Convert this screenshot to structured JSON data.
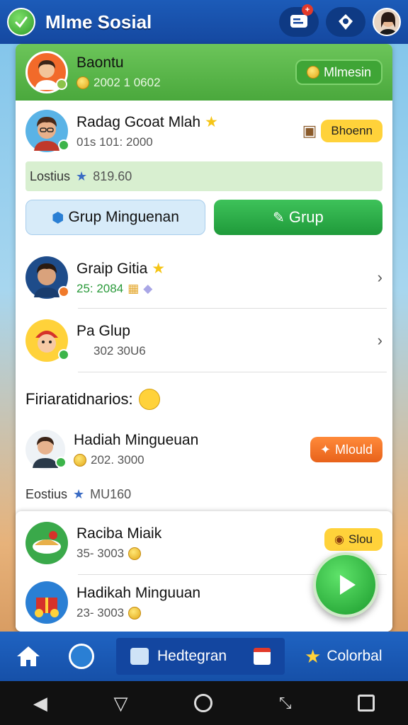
{
  "app": {
    "title": "Mlme Sosial",
    "notification_badge": "+"
  },
  "header": {
    "name": "Baontu",
    "coins": "2002 1 0602",
    "button": "Mlmesin"
  },
  "profile_card": {
    "name": "Radag Gcoat Mlah",
    "sub": "01s 101: 2000",
    "button": "Bhoenn",
    "stat_label": "Lostius",
    "stat_value": "819.60"
  },
  "actions": {
    "left": "Grup Minguenan",
    "right": "Grup"
  },
  "groups": [
    {
      "name": "Graip Gitia",
      "sub": "25: 2084"
    },
    {
      "name": "Pa Glup",
      "sub": "302 30U6"
    }
  ],
  "section": {
    "title": "Firiaratidnarios:"
  },
  "reward": {
    "name": "Hadiah Mingueuan",
    "sub": "202. 3000",
    "button": "Mlould",
    "stat_label": "Eostius",
    "stat_value": "MU160"
  },
  "lower": [
    {
      "name": "Raciba Miaik",
      "sub": "35- 3003",
      "button": "Slou"
    },
    {
      "name": "Hadikah Minguuan",
      "sub": "23- 3003"
    }
  ],
  "bottom_nav": {
    "center_label": "Hedtegran",
    "right_label": "Colorbal"
  },
  "colors": {
    "primary_blue": "#1c5bb8",
    "green": "#4aa83c",
    "orange": "#f07a2a",
    "yellow": "#ffd23a"
  }
}
